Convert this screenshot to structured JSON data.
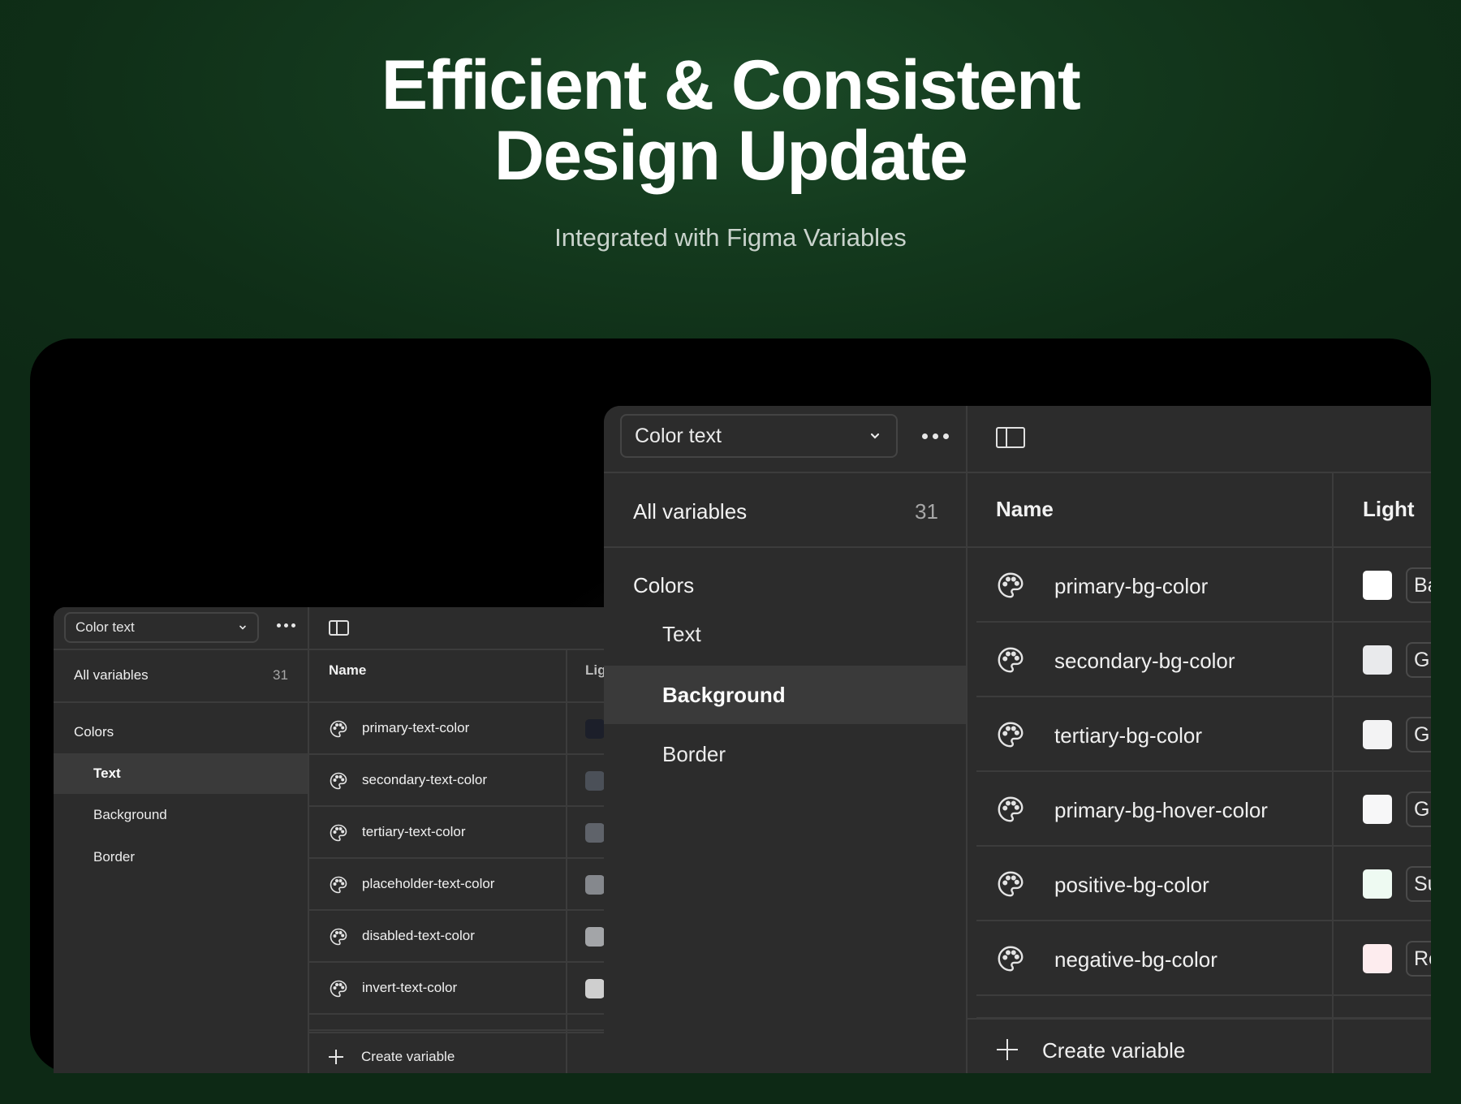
{
  "hero": {
    "title_line1": "Efficient & Consistent",
    "title_line2": "Design Update",
    "subtitle": "Integrated with Figma Variables"
  },
  "panel_small": {
    "collection_select": "Color text",
    "all_variables_label": "All variables",
    "all_variables_count": "31",
    "nav": {
      "group": "Colors",
      "items": [
        {
          "label": "Text",
          "active": true
        },
        {
          "label": "Background",
          "active": false
        },
        {
          "label": "Border",
          "active": false
        }
      ]
    },
    "columns": {
      "name": "Name",
      "light": "Lig"
    },
    "rows": [
      {
        "name": "primary-text-color",
        "swatch": "#1c1f2a"
      },
      {
        "name": "secondary-text-color",
        "swatch": "#4b5058"
      },
      {
        "name": "tertiary-text-color",
        "swatch": "#5f636a"
      },
      {
        "name": "placeholder-text-color",
        "swatch": "#85888d"
      },
      {
        "name": "disabled-text-color",
        "swatch": "#a3a5a8"
      },
      {
        "name": "invert-text-color",
        "swatch": "#cfcfcf"
      }
    ],
    "create_label": "Create variable"
  },
  "panel_large": {
    "collection_select": "Color text",
    "all_variables_label": "All variables",
    "all_variables_count": "31",
    "nav": {
      "group": "Colors",
      "items": [
        {
          "label": "Text",
          "active": false
        },
        {
          "label": "Background",
          "active": true
        },
        {
          "label": "Border",
          "active": false
        }
      ]
    },
    "columns": {
      "name": "Name",
      "light": "Light"
    },
    "rows": [
      {
        "name": "primary-bg-color",
        "swatch": "#ffffff",
        "chip": "Ba"
      },
      {
        "name": "secondary-bg-color",
        "swatch": "#e9eaec",
        "chip": "G"
      },
      {
        "name": "tertiary-bg-color",
        "swatch": "#f3f3f4",
        "chip": "G"
      },
      {
        "name": "primary-bg-hover-color",
        "swatch": "#f7f7f8",
        "chip": "G"
      },
      {
        "name": "positive-bg-color",
        "swatch": "#eefaf2",
        "chip": "Su"
      },
      {
        "name": "negative-bg-color",
        "swatch": "#fdecee",
        "chip": "Re"
      }
    ],
    "create_label": "Create variable"
  },
  "colors": {
    "page_bg": "#123a1d",
    "stage_bg": "#000000",
    "panel_bg": "#2c2c2c",
    "panel_border": "#3c3c3c",
    "active_nav_bg": "#3a3a3a"
  }
}
